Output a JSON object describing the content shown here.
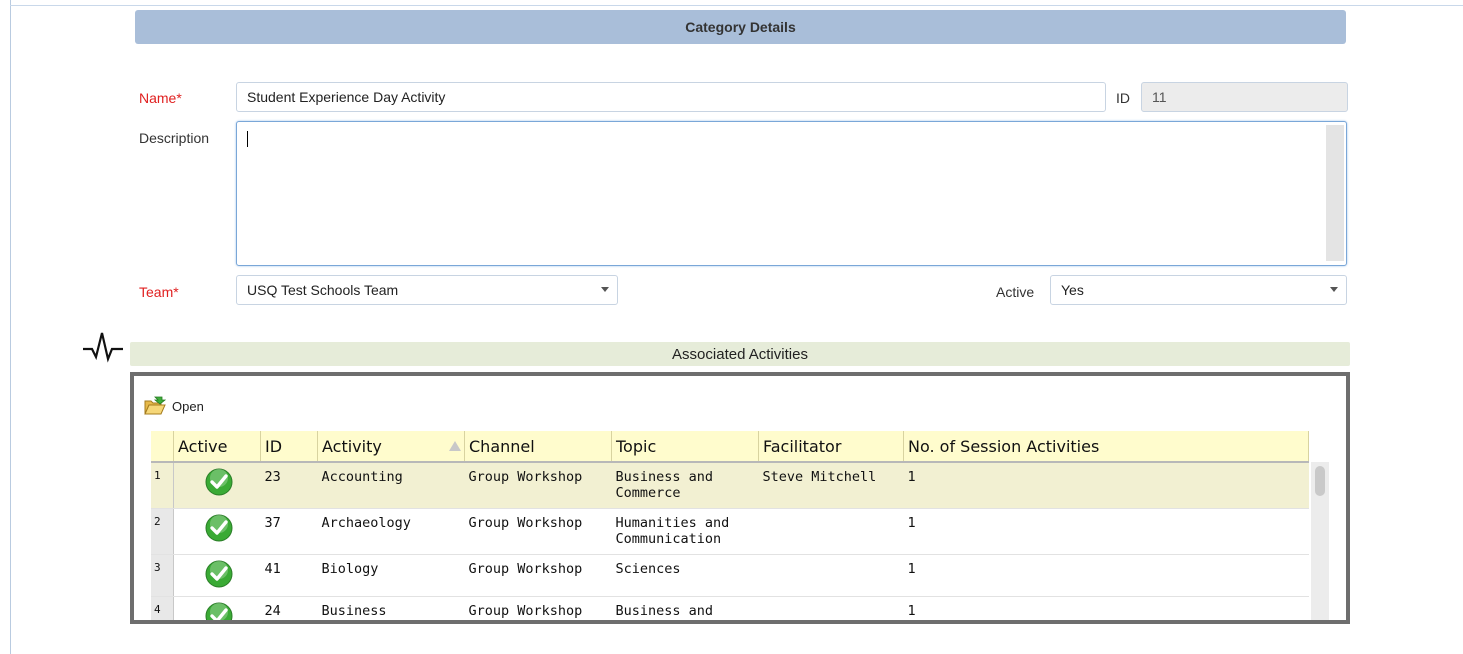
{
  "form": {
    "header": "Category Details",
    "name_label": "Name",
    "required_mark": "*",
    "name_value": "Student Experience Day Activity",
    "id_label": "ID",
    "id_value": "11",
    "description_label": "Description",
    "description_value": "",
    "team_label": "Team",
    "team_value": "USQ Test Schools Team",
    "active_label": "Active",
    "active_value": "Yes"
  },
  "associated": {
    "title": "Associated Activities",
    "open_label": "Open",
    "columns": [
      "Active",
      "ID",
      "Activity",
      "Channel",
      "Topic",
      "Facilitator",
      "No. of Session Activities"
    ],
    "rows": [
      {
        "num": "1",
        "active": true,
        "id": "23",
        "activity": "Accounting",
        "channel": "Group Workshop",
        "topic_line1": "Business and",
        "topic_line2": "Commerce",
        "facilitator": "Steve Mitchell",
        "sessions": "1"
      },
      {
        "num": "2",
        "active": true,
        "id": "37",
        "activity": "Archaeology",
        "channel": "Group Workshop",
        "topic_line1": "Humanities and",
        "topic_line2": "Communication",
        "facilitator": "",
        "sessions": "1"
      },
      {
        "num": "3",
        "active": true,
        "id": "41",
        "activity": "Biology",
        "channel": "Group Workshop",
        "topic_line1": "Sciences",
        "topic_line2": "",
        "facilitator": "",
        "sessions": "1"
      },
      {
        "num": "4",
        "active": true,
        "id": "24",
        "activity": "Business",
        "channel": "Group Workshop",
        "topic_line1": "Business and",
        "topic_line2": "",
        "facilitator": "",
        "sessions": "1"
      }
    ]
  },
  "colors": {
    "header_bar": "#a9bed9",
    "required_label": "#e02020",
    "assoc_bar": "#e6ecd9",
    "grid_header": "#fffccd",
    "selected_row": "#f2f0d2",
    "check_green": "#3aaa35"
  },
  "icons": {
    "pulse": "activity-pulse-icon",
    "open": "folder-open-icon",
    "active": "check-circle-icon",
    "sort": "sort-ascending-icon"
  }
}
